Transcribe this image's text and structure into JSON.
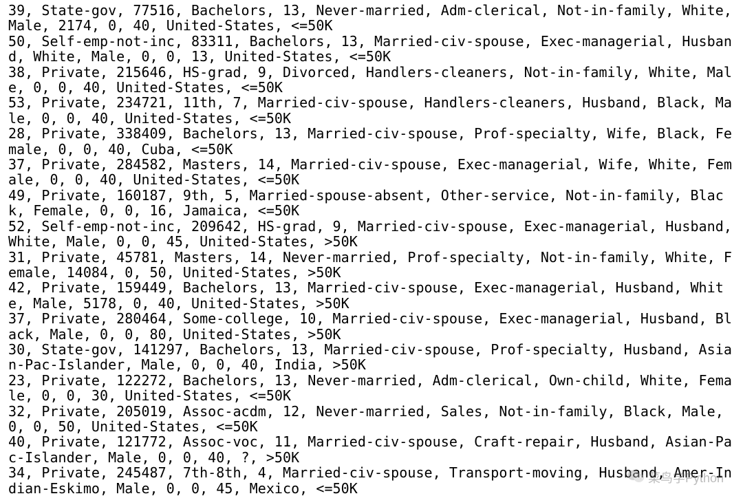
{
  "records": [
    "39, State-gov, 77516, Bachelors, 13, Never-married, Adm-clerical, Not-in-family, White, Male, 2174, 0, 40, United-States, <=50K",
    "50, Self-emp-not-inc, 83311, Bachelors, 13, Married-civ-spouse, Exec-managerial, Husband, White, Male, 0, 0, 13, United-States, <=50K",
    "38, Private, 215646, HS-grad, 9, Divorced, Handlers-cleaners, Not-in-family, White, Male, 0, 0, 40, United-States, <=50K",
    "53, Private, 234721, 11th, 7, Married-civ-spouse, Handlers-cleaners, Husband, Black, Male, 0, 0, 40, United-States, <=50K",
    "28, Private, 338409, Bachelors, 13, Married-civ-spouse, Prof-specialty, Wife, Black, Female, 0, 0, 40, Cuba, <=50K",
    "37, Private, 284582, Masters, 14, Married-civ-spouse, Exec-managerial, Wife, White, Female, 0, 0, 40, United-States, <=50K",
    "49, Private, 160187, 9th, 5, Married-spouse-absent, Other-service, Not-in-family, Black, Female, 0, 0, 16, Jamaica, <=50K",
    "52, Self-emp-not-inc, 209642, HS-grad, 9, Married-civ-spouse, Exec-managerial, Husband, White, Male, 0, 0, 45, United-States, >50K",
    "31, Private, 45781, Masters, 14, Never-married, Prof-specialty, Not-in-family, White, Female, 14084, 0, 50, United-States, >50K",
    "42, Private, 159449, Bachelors, 13, Married-civ-spouse, Exec-managerial, Husband, White, Male, 5178, 0, 40, United-States, >50K",
    "37, Private, 280464, Some-college, 10, Married-civ-spouse, Exec-managerial, Husband, Black, Male, 0, 0, 80, United-States, >50K",
    "30, State-gov, 141297, Bachelors, 13, Married-civ-spouse, Prof-specialty, Husband, Asian-Pac-Islander, Male, 0, 0, 40, India, >50K",
    "23, Private, 122272, Bachelors, 13, Never-married, Adm-clerical, Own-child, White, Female, 0, 0, 30, United-States, <=50K",
    "32, Private, 205019, Assoc-acdm, 12, Never-married, Sales, Not-in-family, Black, Male, 0, 0, 50, United-States, <=50K",
    "40, Private, 121772, Assoc-voc, 11, Married-civ-spouse, Craft-repair, Husband, Asian-Pac-Islander, Male, 0, 0, 40, ?, >50K",
    "34, Private, 245487, 7th-8th, 4, Married-civ-spouse, Transport-moving, Husband, Amer-Indian-Eskimo, Male, 0, 0, 45, Mexico, <=50K"
  ],
  "watermark": {
    "text": "菜鸟学Python",
    "icon": "wechat-icon"
  }
}
